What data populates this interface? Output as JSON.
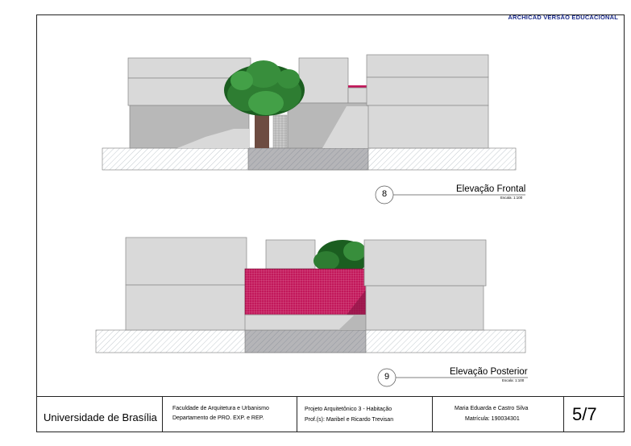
{
  "watermark": "ARCHICAD VERSÃO EDUCACIONAL",
  "drawings": [
    {
      "number": "8",
      "title": "Elevação Frontal",
      "scale": "Escala: 1:100"
    },
    {
      "number": "9",
      "title": "Elevação Posterior",
      "scale": "Escala: 1:100"
    }
  ],
  "title_block": {
    "university": "Universidade de Brasília",
    "faculty_line1": "Faculdade de Arquitetura e Urbanismo",
    "faculty_line2": "Departamento de PRO. EXP. e REP.",
    "project_line1": "Projeto Arquitetônico 3 - Habitação",
    "project_line2": "Prof.(s): Maribel e Ricardo Trevisan",
    "student_name": "Maria Eduarda e Castro Silva",
    "student_id": "Matrícula: 190034301",
    "page": "5/7"
  },
  "colors": {
    "wall": "#d9d9d9",
    "shadow": "#b8b8b8",
    "roof": "#c2185b",
    "tree": "#2e7d32",
    "watermark": "#1a2a8a"
  }
}
